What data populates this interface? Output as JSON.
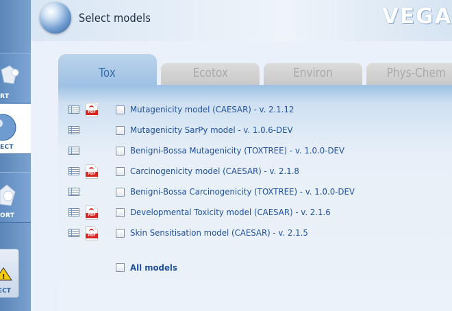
{
  "header": {
    "title": "Select models",
    "brand": "VEGA"
  },
  "sidebar": {
    "items": [
      {
        "label": "RT",
        "icon": "import-icon",
        "active": false
      },
      {
        "label": "ECT",
        "icon": "globe-select-icon",
        "active": true
      },
      {
        "label": "ORT",
        "icon": "export-icon",
        "active": false
      },
      {
        "label": "ECT",
        "icon": "warning-icon",
        "active": false
      }
    ]
  },
  "tabs": [
    {
      "label": "Tox",
      "active": true
    },
    {
      "label": "Ecotox",
      "active": false
    },
    {
      "label": "Environ",
      "active": false
    },
    {
      "label": "Phys-Chem",
      "active": false
    }
  ],
  "models": [
    {
      "label": "Mutagenicity model (CAESAR) - v. 2.1.12",
      "has_pdf": true,
      "checked": false
    },
    {
      "label": "Mutagenicity SarPy model - v. 1.0.6-DEV",
      "has_pdf": false,
      "checked": false
    },
    {
      "label": "Benigni-Bossa Mutagenicity (TOXTREE) - v. 1.0.0-DEV",
      "has_pdf": false,
      "checked": false
    },
    {
      "label": "Carcinogenicity model (CAESAR) - v. 2.1.8",
      "has_pdf": true,
      "checked": false
    },
    {
      "label": "Benigni-Bossa Carcinogenicity (TOXTREE) - v. 1.0.0-DEV",
      "has_pdf": false,
      "checked": false
    },
    {
      "label": "Developmental Toxicity model (CAESAR) - v. 2.1.6",
      "has_pdf": true,
      "checked": false
    },
    {
      "label": "Skin Sensitisation model (CAESAR) - v. 2.1.5",
      "has_pdf": true,
      "checked": false
    }
  ],
  "all_models": {
    "label": "All models",
    "checked": false
  },
  "pdf_badge": "PDF",
  "colors": {
    "link": "#1f4f9c",
    "active_tab": "#9ec1e4",
    "sidebar": "#6b93c4",
    "pdf_red": "#d6261f"
  }
}
